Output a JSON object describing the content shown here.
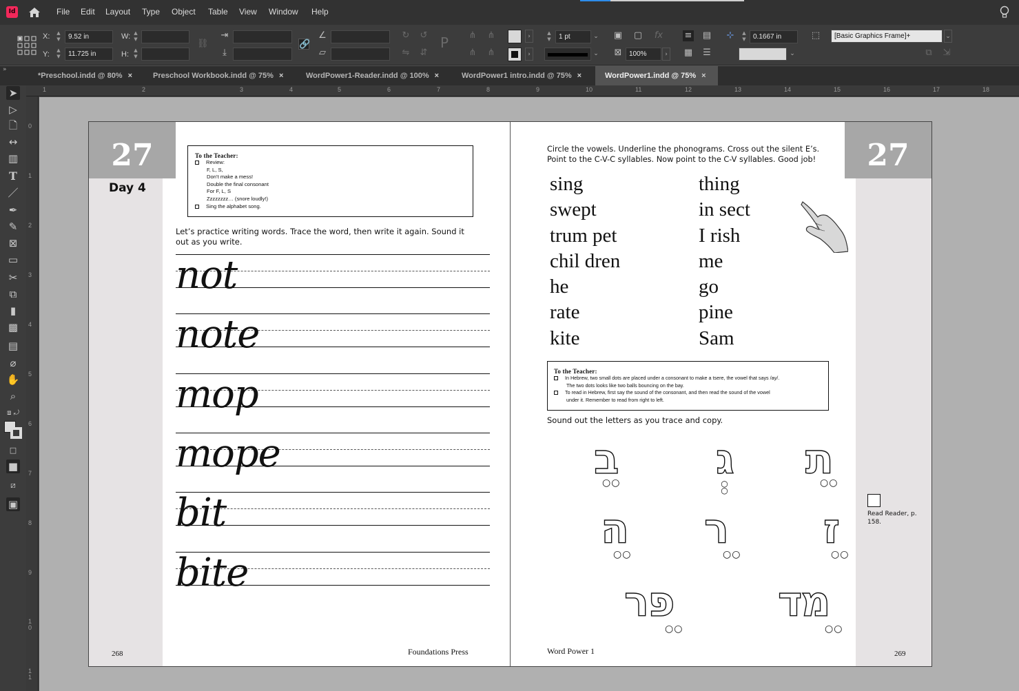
{
  "app": {
    "icon_label": "Id",
    "menu": [
      "File",
      "Edit",
      "Layout",
      "Type",
      "Object",
      "Table",
      "View",
      "Window",
      "Help"
    ]
  },
  "control_panel": {
    "x_label": "X:",
    "x_value": "9.52 in",
    "y_label": "Y:",
    "y_value": "11.725 in",
    "w_label": "W:",
    "w_value": "",
    "h_label": "H:",
    "h_value": "",
    "stroke_weight": "1 pt",
    "opacity": "100%",
    "offset": "0.1667 in",
    "object_style": "[Basic Graphics Frame]+"
  },
  "tabs": [
    {
      "label": "*Preschool.indd @ 80%",
      "active": false
    },
    {
      "label": "Preschool Workbook.indd @ 75%",
      "active": false
    },
    {
      "label": "WordPower1-Reader.indd @ 100%",
      "active": false
    },
    {
      "label": "WordPower1 intro.indd @ 75%",
      "active": false
    },
    {
      "label": "WordPower1.indd @ 75%",
      "active": true
    }
  ],
  "ruler": {
    "horizontal": [
      "1",
      "2",
      "3",
      "4",
      "5",
      "6",
      "7",
      "8",
      "9",
      "10",
      "11",
      "12",
      "13",
      "14",
      "15",
      "16",
      "17",
      "18"
    ],
    "vertical": [
      "0",
      "1",
      "2",
      "3",
      "4",
      "5",
      "6",
      "7",
      "8",
      "9",
      "1 0",
      "1 1"
    ]
  },
  "left_page": {
    "lesson_number": "27",
    "day_label": "Day 4",
    "teacher_box": {
      "title": "To the Teacher:",
      "lines": [
        {
          "checkbox": true,
          "text": "Review:"
        },
        {
          "checkbox": false,
          "text": "F, L, S,"
        },
        {
          "checkbox": false,
          "text": "Don’t make a mess!"
        },
        {
          "checkbox": false,
          "text": "Double the final consonant"
        },
        {
          "checkbox": false,
          "text": "For F, L, S"
        },
        {
          "checkbox": false,
          "text": "Zzzzzzzz… (snore loudly!)"
        },
        {
          "checkbox": true,
          "text": "Sing the alphabet song."
        }
      ]
    },
    "instructions": "Let’s practice writing words. Trace the word, then write it again. Sound it out as you write.",
    "trace_words": [
      "not",
      "note",
      "mop",
      "mope",
      "bit",
      "bite"
    ],
    "footer_page": "268",
    "footer_publisher": "Foundations Press"
  },
  "right_page": {
    "lesson_number": "27",
    "instructions": "Circle the vowels. Underline the phonograms. Cross out the silent E’s. Point to the C-V-C syllables. Now point to the C-V syllables. Good job!",
    "words_col1": [
      "sing",
      "swept",
      "trum pet",
      "chil dren",
      "he",
      "rate",
      "kite"
    ],
    "words_col2": [
      "thing",
      "in sect",
      "I rish",
      "me",
      "go",
      "pine",
      "Sam"
    ],
    "teacher_box": {
      "title": "To the Teacher:",
      "lines": [
        {
          "checkbox": true,
          "text": "In Hebrew, two small dots are placed under a consonant to make a tsere, the vowel that says /ay/."
        },
        {
          "checkbox": false,
          "text": "The two dots looks like two balls bouncing on the bay."
        },
        {
          "checkbox": true,
          "text": "To read in Hebrew, first say the sound of the consonant, and then read the sound of the vowel"
        },
        {
          "checkbox": false,
          "text": "under it. Remember to read from right to left."
        }
      ]
    },
    "trace_instructions": "Sound out the letters as you trace and copy.",
    "hebrew_letters": [
      "ב",
      "ג",
      "ת",
      "ה",
      "ר",
      "ז",
      "פר",
      "מד"
    ],
    "reader_note": "Read Reader, p. 158.",
    "footer_title": "Word Power 1",
    "footer_page": "269"
  }
}
